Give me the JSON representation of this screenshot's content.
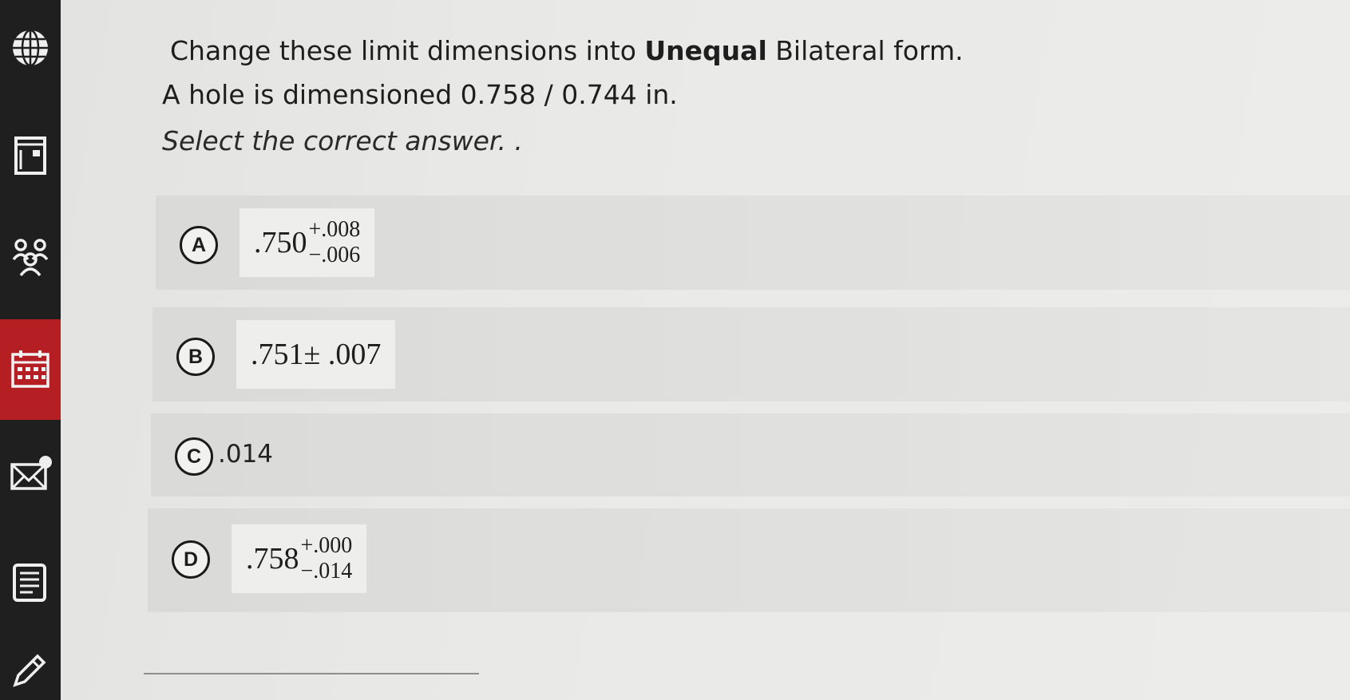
{
  "sidebar": {
    "icons": [
      "globe-icon",
      "book-icon",
      "people-icon",
      "calendar-icon",
      "mail-icon",
      "notes-icon",
      "edit-icon"
    ],
    "active_index": 3,
    "active_color": "#b51f24"
  },
  "question": {
    "line1_before": "Change these limit dimensions into ",
    "line1_bold": "Unequal",
    "line1_after": " Bilateral form.",
    "line2": "A hole is dimensioned 0.758 / 0.744 in.",
    "instruction": "Select the correct answer. ."
  },
  "options": [
    {
      "letter": "A",
      "base": ".750",
      "plus": "+.008",
      "minus": "−.006"
    },
    {
      "letter": "B",
      "text": ".751± .007"
    },
    {
      "letter": "C",
      "text": ".014"
    },
    {
      "letter": "D",
      "base": ".758",
      "plus": "+.000",
      "minus": "−.014"
    }
  ]
}
